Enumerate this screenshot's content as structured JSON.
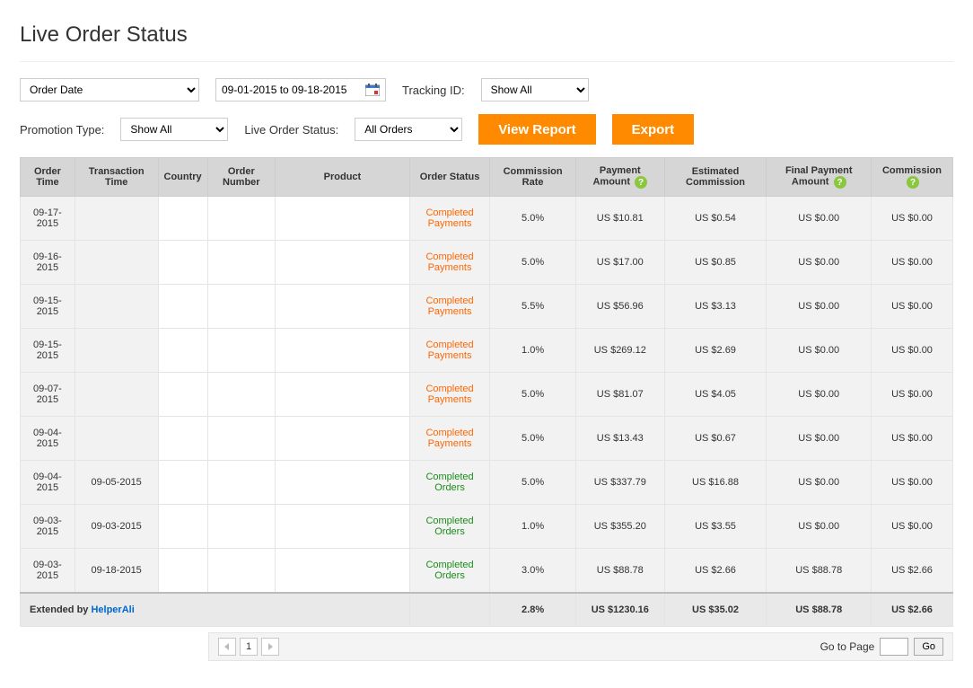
{
  "title": "Live Order Status",
  "filters": {
    "order_date_select": "Order Date",
    "date_range": "09-01-2015 to 09-18-2015",
    "tracking_label": "Tracking ID:",
    "tracking_select": "Show All",
    "promotion_label": "Promotion Type:",
    "promotion_select": "Show All",
    "status_label": "Live Order Status:",
    "status_select": "All Orders",
    "view_report_btn": "View Report",
    "export_btn": "Export"
  },
  "columns": [
    "Order Time",
    "Transaction Time",
    "Country",
    "Order Number",
    "Product",
    "Order Status",
    "Commission Rate",
    "Payment Amount",
    "Estimated Commission",
    "Final Payment Amount",
    "Commission"
  ],
  "rows": [
    {
      "order_time": "09-17-2015",
      "txn_time": "",
      "status": "Completed Payments",
      "status_style": "orange",
      "rate": "5.0%",
      "pay": "US $10.81",
      "est": "US $0.54",
      "final": "US $0.00",
      "comm": "US $0.00"
    },
    {
      "order_time": "09-16-2015",
      "txn_time": "",
      "status": "Completed Payments",
      "status_style": "orange",
      "rate": "5.0%",
      "pay": "US $17.00",
      "est": "US $0.85",
      "final": "US $0.00",
      "comm": "US $0.00"
    },
    {
      "order_time": "09-15-2015",
      "txn_time": "",
      "status": "Completed Payments",
      "status_style": "orange",
      "rate": "5.5%",
      "pay": "US $56.96",
      "est": "US $3.13",
      "final": "US $0.00",
      "comm": "US $0.00"
    },
    {
      "order_time": "09-15-2015",
      "txn_time": "",
      "status": "Completed Payments",
      "status_style": "orange",
      "rate": "1.0%",
      "pay": "US $269.12",
      "est": "US $2.69",
      "final": "US $0.00",
      "comm": "US $0.00"
    },
    {
      "order_time": "09-07-2015",
      "txn_time": "",
      "status": "Completed Payments",
      "status_style": "orange",
      "rate": "5.0%",
      "pay": "US $81.07",
      "est": "US $4.05",
      "final": "US $0.00",
      "comm": "US $0.00"
    },
    {
      "order_time": "09-04-2015",
      "txn_time": "",
      "status": "Completed Payments",
      "status_style": "orange",
      "rate": "5.0%",
      "pay": "US $13.43",
      "est": "US $0.67",
      "final": "US $0.00",
      "comm": "US $0.00"
    },
    {
      "order_time": "09-04-2015",
      "txn_time": "09-05-2015",
      "status": "Completed Orders",
      "status_style": "green",
      "rate": "5.0%",
      "pay": "US $337.79",
      "est": "US $16.88",
      "final": "US $0.00",
      "comm": "US $0.00"
    },
    {
      "order_time": "09-03-2015",
      "txn_time": "09-03-2015",
      "status": "Completed Orders",
      "status_style": "green",
      "rate": "1.0%",
      "pay": "US $355.20",
      "est": "US $3.55",
      "final": "US $0.00",
      "comm": "US $0.00"
    },
    {
      "order_time": "09-03-2015",
      "txn_time": "09-18-2015",
      "status": "Completed Orders",
      "status_style": "green",
      "rate": "3.0%",
      "pay": "US $88.78",
      "est": "US $2.66",
      "final": "US $88.78",
      "comm": "US $2.66"
    }
  ],
  "totals": {
    "extended_by_prefix": "Extended by ",
    "extended_by_link": "HelperAli",
    "rate": "2.8%",
    "pay": "US $1230.16",
    "est": "US $35.02",
    "final": "US $88.78",
    "comm": "US $2.66"
  },
  "pager": {
    "page": "1",
    "goto_label": "Go to Page",
    "go_btn": "Go"
  }
}
